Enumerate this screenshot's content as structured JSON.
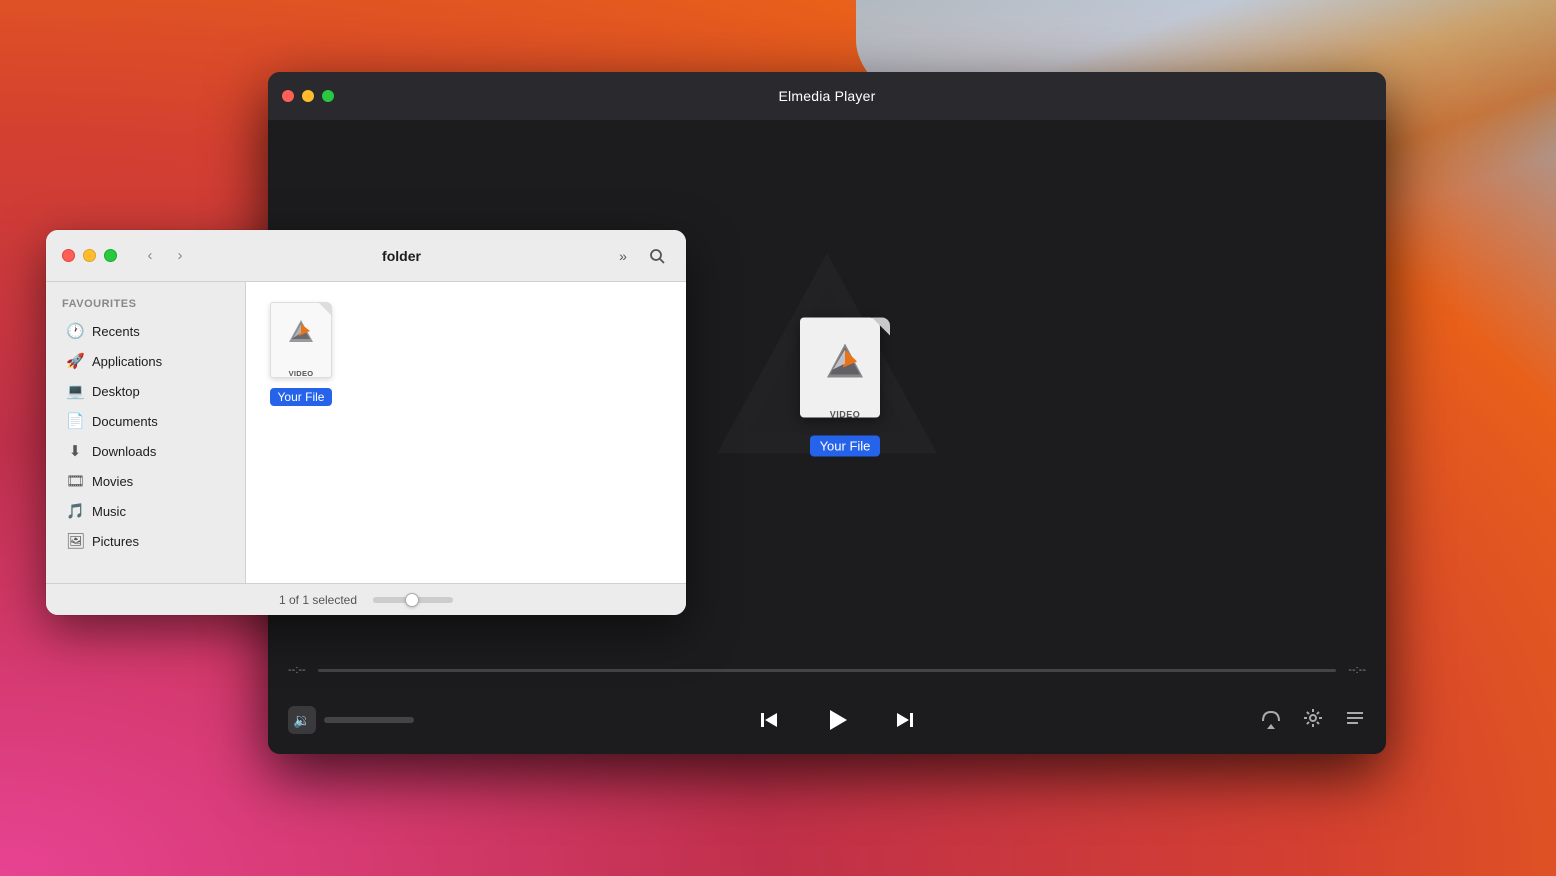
{
  "desktop": {
    "background": "macOS Big Sur gradient"
  },
  "player": {
    "title": "Elmedia Player",
    "traffic_lights": [
      "red",
      "yellow",
      "green"
    ],
    "time_start": "--:--",
    "time_end": "--:--",
    "file_name": "Your File",
    "file_type_label": "VIDEO",
    "controls": {
      "prev_label": "⏮",
      "play_label": "▶",
      "next_label": "⏭",
      "airplay_label": "airplay",
      "settings_label": "settings",
      "playlist_label": "playlist"
    }
  },
  "finder": {
    "title": "folder",
    "traffic_lights": {
      "red": "close",
      "yellow": "minimize",
      "green": "maximize"
    },
    "sidebar": {
      "section_label": "Favourites",
      "items": [
        {
          "label": "Recents",
          "icon": "🕐"
        },
        {
          "label": "Applications",
          "icon": "🚀"
        },
        {
          "label": "Desktop",
          "icon": "💻"
        },
        {
          "label": "Documents",
          "icon": "📄"
        },
        {
          "label": "Downloads",
          "icon": "⬇"
        },
        {
          "label": "Movies",
          "icon": "🎞"
        },
        {
          "label": "Music",
          "icon": "🎵"
        },
        {
          "label": "Pictures",
          "icon": "🖼"
        }
      ]
    },
    "file": {
      "name": "Your File",
      "type_label": "VIDEO"
    },
    "statusbar": {
      "selected_text": "1 of 1 selected"
    }
  }
}
